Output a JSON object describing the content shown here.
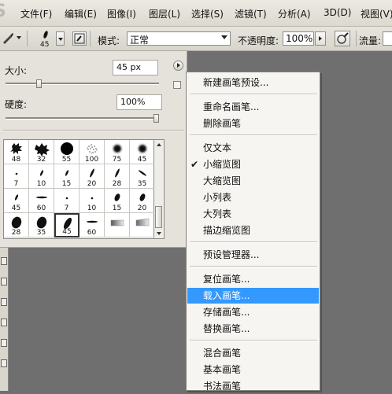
{
  "menubar": {
    "items": [
      "文件(F)",
      "编辑(E)",
      "图像(I)",
      "图层(L)",
      "选择(S)",
      "滤镜(T)",
      "分析(A)",
      "3D(D)",
      "视图(V)"
    ]
  },
  "options": {
    "brush_size": "45",
    "mode_label": "模式:",
    "mode_value": "正常",
    "opacity_label": "不透明度:",
    "opacity_value": "100%",
    "flow_label": "流量:"
  },
  "brush_panel": {
    "size_label": "大小:",
    "size_value": "45 px",
    "hardness_label": "硬度:",
    "hardness_value": "100%",
    "size_slider": 0.22,
    "hardness_slider": 1.0,
    "brushes": [
      {
        "num": "48",
        "shape": "splat"
      },
      {
        "num": "32",
        "shape": "splat2"
      },
      {
        "num": "55",
        "shape": "disc-hard"
      },
      {
        "num": "100",
        "shape": "spray"
      },
      {
        "num": "75",
        "shape": "disc-soft"
      },
      {
        "num": "45",
        "shape": "disc-soft"
      },
      {
        "num": "7",
        "shape": "dot"
      },
      {
        "num": "10",
        "shape": "tilt"
      },
      {
        "num": "15",
        "shape": "tilt"
      },
      {
        "num": "20",
        "shape": "tilt-long"
      },
      {
        "num": "28",
        "shape": "tilt-long"
      },
      {
        "num": "35",
        "shape": "tilt-back"
      },
      {
        "num": "45",
        "shape": "tilt"
      },
      {
        "num": "60",
        "shape": "flat"
      },
      {
        "num": "7",
        "shape": "dot"
      },
      {
        "num": "10",
        "shape": "dot"
      },
      {
        "num": "15",
        "shape": "oval"
      },
      {
        "num": "20",
        "shape": "oval"
      },
      {
        "num": "28",
        "shape": "oval-big"
      },
      {
        "num": "35",
        "shape": "oval-big"
      },
      {
        "num": "45",
        "shape": "oval-tilt"
      },
      {
        "num": "60",
        "shape": "flat"
      },
      {
        "num": "",
        "shape": "grad"
      },
      {
        "num": "",
        "shape": "grad2"
      }
    ],
    "selected_index": 20
  },
  "menu": {
    "items": [
      {
        "label": "新建画笔预设...",
        "type": "item"
      },
      {
        "type": "sep"
      },
      {
        "label": "重命名画笔...",
        "type": "item"
      },
      {
        "label": "删除画笔",
        "type": "item"
      },
      {
        "type": "sep"
      },
      {
        "label": "仅文本",
        "type": "item"
      },
      {
        "label": "小缩览图",
        "type": "item",
        "checked": true
      },
      {
        "label": "大缩览图",
        "type": "item"
      },
      {
        "label": "小列表",
        "type": "item"
      },
      {
        "label": "大列表",
        "type": "item"
      },
      {
        "label": "描边缩览图",
        "type": "item"
      },
      {
        "type": "sep"
      },
      {
        "label": "预设管理器...",
        "type": "item"
      },
      {
        "type": "sep"
      },
      {
        "label": "复位画笔...",
        "type": "item"
      },
      {
        "label": "载入画笔...",
        "type": "item",
        "highlighted": true
      },
      {
        "label": "存储画笔...",
        "type": "item"
      },
      {
        "label": "替换画笔...",
        "type": "item"
      },
      {
        "type": "sep"
      },
      {
        "label": "混合画笔",
        "type": "item"
      },
      {
        "label": "基本画笔",
        "type": "item"
      },
      {
        "label": "书法画笔",
        "type": "item"
      }
    ],
    "check_mark": "✔",
    "highlight_color": "#3399ff"
  }
}
